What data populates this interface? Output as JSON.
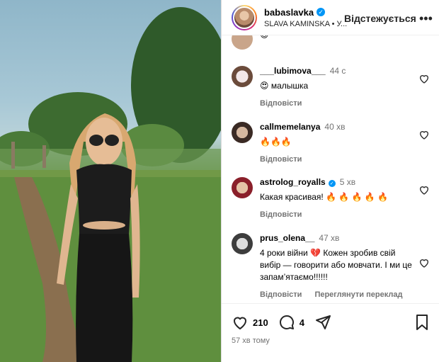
{
  "header": {
    "username": "babaslavka",
    "subtitle": "SLAVA KAMINSKA • У...",
    "follow_label": "Відстежується",
    "more_icon": "more-horizontal-icon"
  },
  "partial_top_emoji": "😊",
  "comments": [
    {
      "user": "___lubimova___",
      "time": "44 с",
      "text": "😍 малышка",
      "reply": "Відповісти",
      "translate": "",
      "verified": false
    },
    {
      "user": "callmemelanya",
      "time": "40 хв",
      "text": "🔥🔥🔥",
      "reply": "Відповісти",
      "translate": "",
      "verified": false
    },
    {
      "user": "astrolog_royalls",
      "time": "5 хв",
      "text": "Какая красивая! 🔥 🔥 🔥 🔥 🔥",
      "reply": "Відповісти",
      "translate": "",
      "verified": true
    },
    {
      "user": "prus_olena__",
      "time": "47 хв",
      "text": "4 роки війни 💔 Кожен зробив свій вибір — говорити або мовчати. І ми це запам’ятаємо!!!!!!",
      "reply": "Відповісти",
      "translate": "Переглянути переклад",
      "verified": false
    }
  ],
  "actions": {
    "likes": "210",
    "comments": "4",
    "time_ago": "57 хв тому"
  },
  "colors": {
    "accent": "#0095f6",
    "muted": "#737373",
    "border": "#dbdbdb"
  }
}
